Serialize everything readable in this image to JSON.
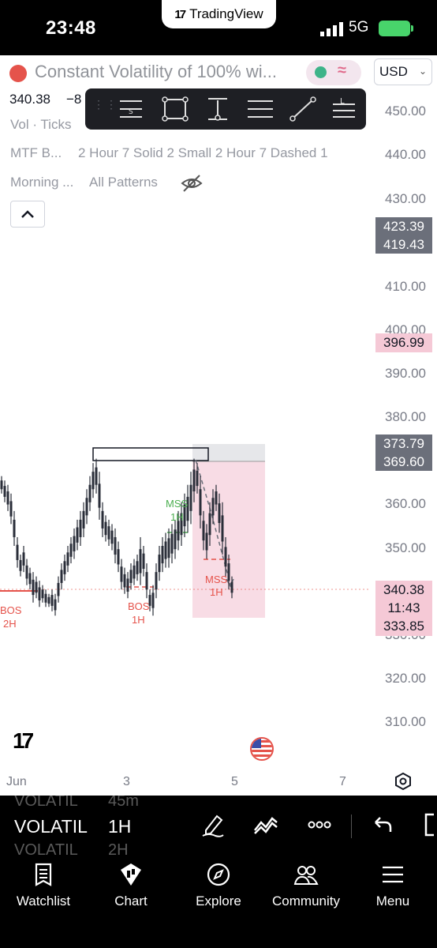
{
  "status_bar": {
    "time": "23:48",
    "app_name": "TradingView",
    "network": "5G"
  },
  "chart_header": {
    "symbol_title": "Constant Volatility of 100% wi...",
    "last_price": "340.38",
    "change": "−8",
    "currency": "USD",
    "volume_label": "Vol · Ticks"
  },
  "drawing_toolbar": {
    "tools": [
      "horizontal-line-icon",
      "rectangle-icon",
      "price-range-icon",
      "parallel-channel-icon",
      "trend-line-icon",
      "long-position-icon"
    ]
  },
  "indicators": {
    "row1": [
      "MTF B...",
      "2 Hour 7 Solid 2 Small 2 Hour 7 Dashed 1"
    ],
    "row2": [
      "Morning ...",
      "All Patterns"
    ]
  },
  "price_axis": {
    "ticks": [
      "450.00",
      "440.00",
      "430.00",
      "410.00",
      "400.00",
      "390.00",
      "380.00",
      "360.00",
      "350.00",
      "330.00",
      "320.00",
      "310.00"
    ],
    "tags": {
      "t1": "423.39",
      "t2": "419.43",
      "t3": "396.99",
      "t4": "373.79",
      "t5": "369.60",
      "t6": "340.38",
      "t6_sub": "11:43",
      "t7": "333.85"
    }
  },
  "chart_annotations": {
    "bos_left": "BOS",
    "bos_left_tf": "2H",
    "bos_mid": "BOS",
    "bos_mid_tf": "1H",
    "mss_green": "MSS",
    "mss_green_tf": "1H",
    "mss_red": "MSS",
    "mss_red_tf": "1H"
  },
  "time_axis": {
    "ticks": [
      "Jun",
      "3",
      "5",
      "7"
    ]
  },
  "symbol_bar": {
    "symbol": "VOLATIL",
    "interval": "1H",
    "ghost_symbol_top": "VOLATIL",
    "ghost_interval_top": "45m",
    "ghost_symbol_bottom": "VOLATIL",
    "ghost_interval_bottom": "2H"
  },
  "nav": {
    "items": [
      {
        "label": "Watchlist",
        "icon": "watchlist-icon"
      },
      {
        "label": "Chart",
        "icon": "chart-icon"
      },
      {
        "label": "Explore",
        "icon": "compass-icon"
      },
      {
        "label": "Community",
        "icon": "community-icon"
      },
      {
        "label": "Menu",
        "icon": "menu-icon"
      }
    ]
  },
  "colors": {
    "bearish_zone": "#f4c6d4",
    "bos_red": "#e5534b",
    "mss_green": "#4caf50",
    "price_tag_gray": "#6b6f7a",
    "price_tag_pink": "#f5c9d6"
  }
}
